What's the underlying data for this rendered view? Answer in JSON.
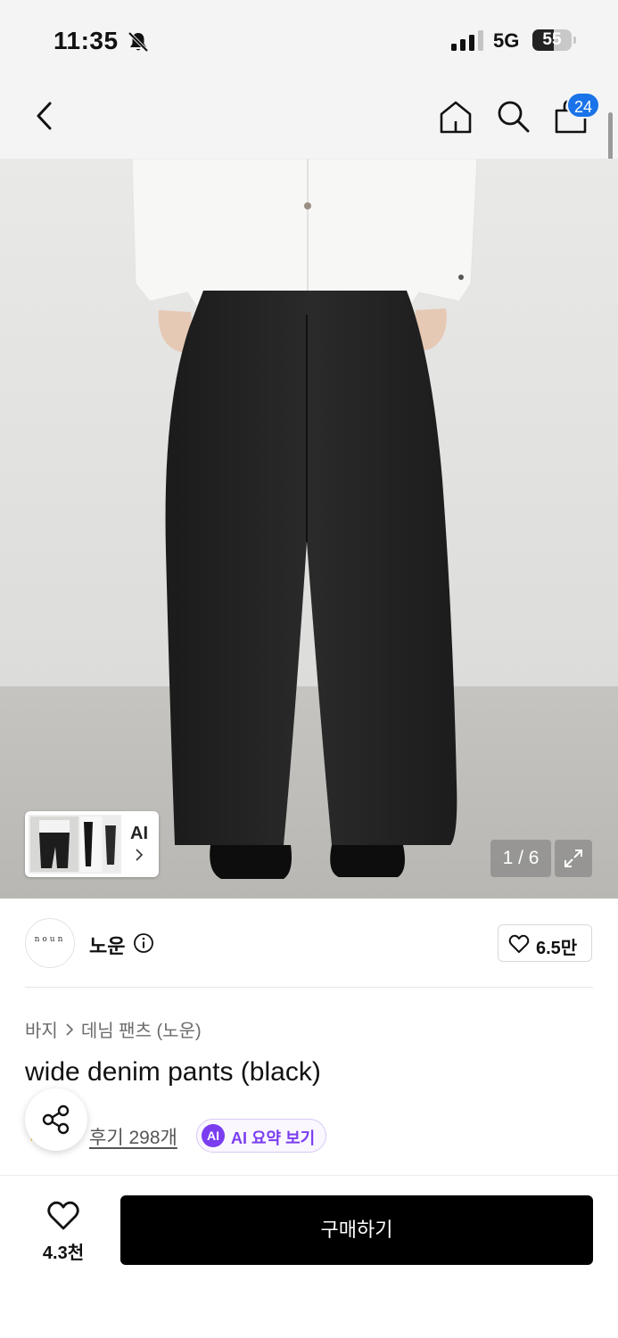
{
  "status_bar": {
    "time": "11:35",
    "network": "5G",
    "battery_level": "55",
    "battery_fraction": 0.55,
    "icons": [
      "bell-slash-icon",
      "signal-icon",
      "battery-icon"
    ]
  },
  "nav": {
    "icons": [
      "back-icon",
      "home-icon",
      "search-icon",
      "cart-icon"
    ],
    "cart_count": "24",
    "badge_color": "#1a73e8"
  },
  "gallery": {
    "thumb_label": "AI",
    "pager": "1 / 6",
    "current_image": 1,
    "total_images": 6
  },
  "brand": {
    "logo_text": "noun",
    "name": "노운",
    "like_count": "6.5만"
  },
  "product": {
    "breadcrumb": [
      "바지",
      "데님 팬츠 (노운)"
    ],
    "title": "wide denim pants (black)",
    "review_link": "후기 298개",
    "ai_badge": "AI",
    "ai_summary_label": "AI 요약 보기",
    "accent_color": "#7a3df0"
  },
  "bottom_bar": {
    "wish_count": "4.3천",
    "buy_label": "구매하기"
  }
}
